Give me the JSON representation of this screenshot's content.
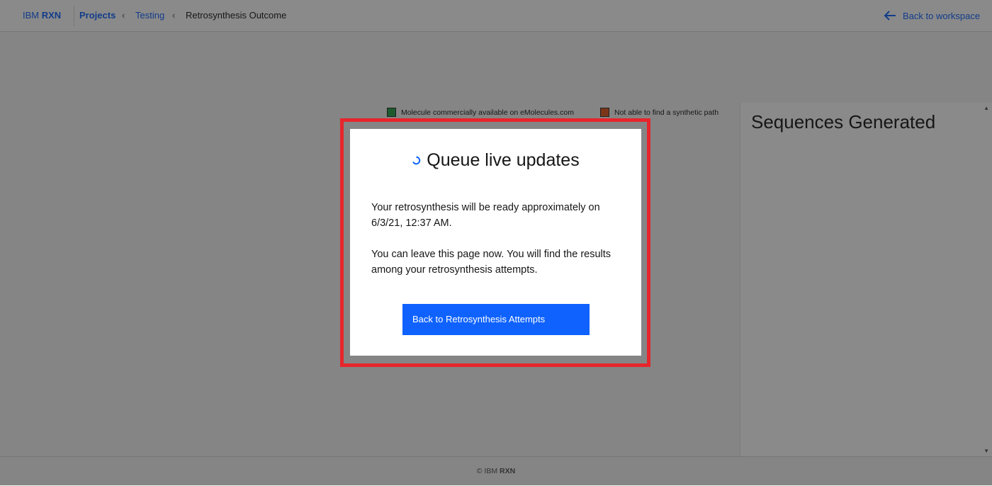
{
  "header": {
    "brand_prefix": "IBM",
    "brand_suffix": "RXN",
    "breadcrumbs": [
      {
        "label": "Projects"
      },
      {
        "label": "Testing"
      },
      {
        "label": "Retrosynthesis Outcome"
      }
    ],
    "back_label": "Back to workspace"
  },
  "legend": [
    {
      "label": "Molecule commercially available on eMolecules.com",
      "color": "#24a148"
    },
    {
      "label": "Not able to find a synthetic path",
      "color": "#e0571d"
    }
  ],
  "side_panel": {
    "title": "Sequences Generated"
  },
  "modal": {
    "title": "Queue live updates",
    "message_ready": "Your retrosynthesis will be ready approximately on 6/3/21, 12:37 AM.",
    "message_leave": "You can leave this page now. You will find the results among your retrosynthesis attempts.",
    "button_label": "Back to Retrosynthesis Attempts"
  },
  "footer": {
    "prefix": "© IBM",
    "suffix": "RXN"
  },
  "colors": {
    "accent": "#0f62fe",
    "highlight_border": "#e6262c"
  }
}
